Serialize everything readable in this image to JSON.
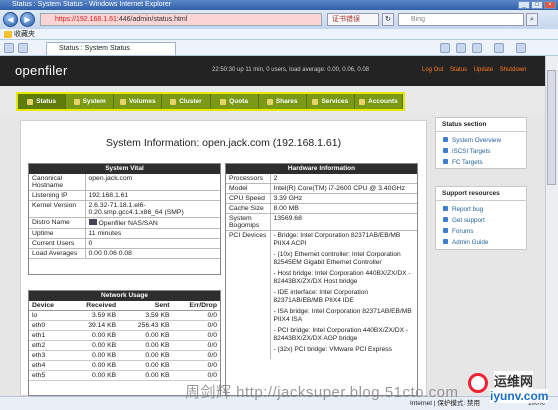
{
  "browser": {
    "window_title": "Status : System Status - Windows Internet Explorer",
    "address_host": "https://192.168.1.61",
    "address_path": ":446/admin/status.html",
    "cert_label": "证书错误",
    "search_placeholder": "Bing",
    "favorites_label": "收藏夹",
    "tab_label": "Status : System Status",
    "status_left": "",
    "status_zone": "Internet | 保护模式: 禁用",
    "status_zoom": "100%"
  },
  "header": {
    "logo": "openfiler",
    "uptime": "22:50:30 up 11 min, 0 users, load average: 0.00, 0.06, 0.08",
    "links": [
      "Log Out",
      "Status",
      "Update",
      "Shutdown"
    ]
  },
  "menu": [
    "Status",
    "System",
    "Volumes",
    "Cluster",
    "Quota",
    "Shares",
    "Services",
    "Accounts"
  ],
  "main": {
    "title": "System Information: open.jack.com (192.168.1.61)"
  },
  "system_vital": {
    "heading": "System Vital",
    "rows": [
      {
        "k": "Canonical Hostname",
        "v": "open.jack.com"
      },
      {
        "k": "Listening IP",
        "v": "192.168.1.61"
      },
      {
        "k": "Kernel Version",
        "v": "2.6.32-71.18.1.el6-0.20.smp.gcc4.1.x86_64 (SMP)"
      },
      {
        "k": "Distro Name",
        "v": "Openfiler NAS/SAN"
      },
      {
        "k": "Uptime",
        "v": "11 minutes"
      },
      {
        "k": "Current Users",
        "v": "0"
      },
      {
        "k": "Load Averages",
        "v": "0.00 0.06 0.08"
      }
    ]
  },
  "hardware": {
    "heading": "Hardware Information",
    "rows": [
      {
        "k": "Processors",
        "v": "2"
      },
      {
        "k": "Model",
        "v": "Intel(R) Core(TM) i7-2600 CPU @ 3.40GHz"
      },
      {
        "k": "CPU Speed",
        "v": "3.39 GHz"
      },
      {
        "k": "Cache Size",
        "v": "8.00 MB"
      },
      {
        "k": "System Bogomips",
        "v": "13569.68"
      }
    ],
    "pci_label": "PCI Devices",
    "pci": [
      "Bridge: Intel Corporation 82371AB/EB/MB PIIX4 ACPI",
      "(10x) Ethernet controller: Intel Corporation 82545EM Gigabit Ethernet Controller",
      "Host bridge: Intel Corporation 440BX/ZX/DX - 82443BX/ZX/DX Host bridge",
      "IDE interface: Intel Corporation 82371AB/EB/MB PIIX4 IDE",
      "ISA bridge: Intel Corporation 82371AB/EB/MB PIIX4 ISA",
      "PCI bridge: Intel Corporation 440BX/ZX/DX - 82443BX/ZX/DX AGP bridge",
      "(32x) PCI bridge: VMware PCI Express"
    ]
  },
  "network": {
    "heading": "Network Usage",
    "columns": [
      "Device",
      "Received",
      "Sent",
      "Err/Drop"
    ],
    "rows": [
      [
        "lo",
        "3.59 KB",
        "3.59 KB",
        "0/0"
      ],
      [
        "eth0",
        "39.14 KB",
        "256.43 KB",
        "0/0"
      ],
      [
        "eth1",
        "0.00 KB",
        "0.00 KB",
        "0/0"
      ],
      [
        "eth2",
        "0.00 KB",
        "0.00 KB",
        "0/0"
      ],
      [
        "eth3",
        "0.00 KB",
        "0.00 KB",
        "0/0"
      ],
      [
        "eth4",
        "0.00 KB",
        "0.00 KB",
        "0/0"
      ],
      [
        "eth5",
        "0.00 KB",
        "0.00 KB",
        "0/0"
      ]
    ]
  },
  "status_section": {
    "heading": "Status section",
    "links": [
      "System Overview",
      "iSCSI Targets",
      "FC Targets"
    ]
  },
  "support": {
    "heading": "Support resources",
    "links": [
      "Report bug",
      "Get support",
      "Forums",
      "Admin Guide"
    ]
  },
  "watermark": "周剑辉 http://jacksuper.blog.51cto.com",
  "watermark_logo": {
    "line1": "运维网",
    "line2": "iyunv.com"
  }
}
